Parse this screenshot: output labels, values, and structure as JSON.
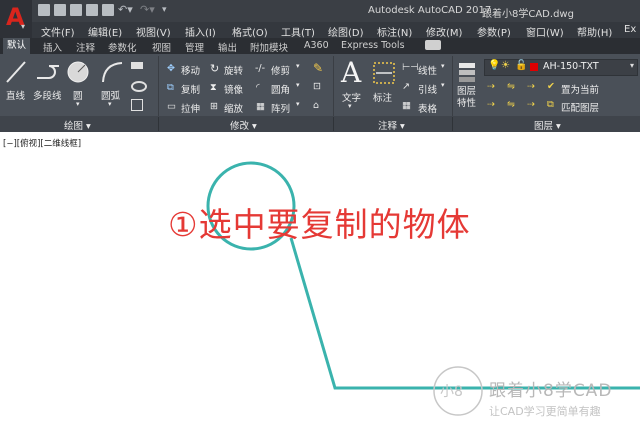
{
  "app": {
    "title": "Autodesk AutoCAD 2017",
    "document": "跟着小8学CAD.dwg",
    "logo_letter": "A"
  },
  "menu": [
    "文件(F)",
    "编辑(E)",
    "视图(V)",
    "插入(I)",
    "格式(O)",
    "工具(T)",
    "绘图(D)",
    "标注(N)",
    "修改(M)",
    "参数(P)",
    "窗口(W)",
    "帮助(H)",
    "Ex"
  ],
  "tabs": [
    "默认",
    "插入",
    "注释",
    "参数化",
    "视图",
    "管理",
    "输出",
    "附加模块",
    "A360",
    "Express Tools"
  ],
  "active_tab": "默认",
  "ribbon": {
    "draw": {
      "title": "绘图",
      "line": "直线",
      "polyline": "多段线",
      "circle": "圆",
      "arc": "圆弧"
    },
    "modify": {
      "title": "修改",
      "move": "移动",
      "rotate": "旋转",
      "trim": "修剪",
      "copy": "复制",
      "mirror": "镜像",
      "fillet": "圆角",
      "stretch": "拉伸",
      "scale": "缩放",
      "array": "阵列"
    },
    "annotation": {
      "title": "注释",
      "text": "文字",
      "dimension": "标注",
      "linear": "线性",
      "leader": "引线",
      "table": "表格"
    },
    "layers": {
      "title": "图层",
      "properties": "图层\n特性",
      "current_layer": "AH-150-TXT",
      "set_current": "置为当前",
      "match_layer": "匹配图层",
      "layer_color": "#e00000"
    }
  },
  "canvas": {
    "view_label": "[−][俯视][二维线框]",
    "instruction": "①选中要复制的物体",
    "instruction_color": "#e53935",
    "line_color": "#3ab3ad",
    "watermark_logo_char": "小8",
    "watermark_name": "跟着小8学CAD",
    "watermark_slogan": "让CAD学习更简单有趣"
  }
}
